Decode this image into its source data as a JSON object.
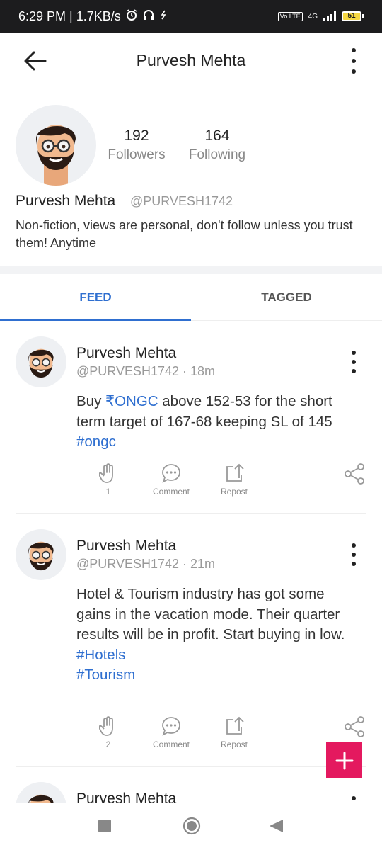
{
  "status_bar": {
    "left_text": "6:29 PM | 1.7KB/s",
    "network": "4G",
    "volte": "Vo LTE",
    "battery": "51"
  },
  "header": {
    "title": "Purvesh Mehta"
  },
  "profile": {
    "followers_count": "192",
    "followers_label": "Followers",
    "following_count": "164",
    "following_label": "Following",
    "name": "Purvesh Mehta",
    "handle": "@PURVESH1742",
    "bio": "Non-fiction, views are personal, don't follow unless you trust them! Anytime"
  },
  "tabs": [
    {
      "label": "FEED",
      "active": true
    },
    {
      "label": "TAGGED",
      "active": false
    }
  ],
  "posts": [
    {
      "author": "Purvesh Mehta",
      "handle": "@PURVESH1742",
      "time": "· 18m",
      "text_prefix": "Buy ",
      "stock_link": "₹ONGC",
      "text_suffix": " above 152-53 for the short term target of 167-68 keeping SL of 145",
      "hashtags": [
        "#ongc"
      ],
      "likes": "1",
      "comment_label": "Comment",
      "repost_label": "Repost"
    },
    {
      "author": "Purvesh Mehta",
      "handle": "@PURVESH1742",
      "time": "· 21m",
      "text": "Hotel & Tourism industry has got some gains in the vacation mode. Their quarter results will be in profit. Start buying in low.",
      "hashtags": [
        "#Hotels",
        "#Tourism"
      ],
      "likes": "2",
      "comment_label": "Comment",
      "repost_label": "Repost"
    },
    {
      "author": "Purvesh Mehta"
    }
  ],
  "colors": {
    "accent": "#2f6fd0",
    "fab": "#e4195f",
    "status_bar": "#1c1c1e"
  }
}
